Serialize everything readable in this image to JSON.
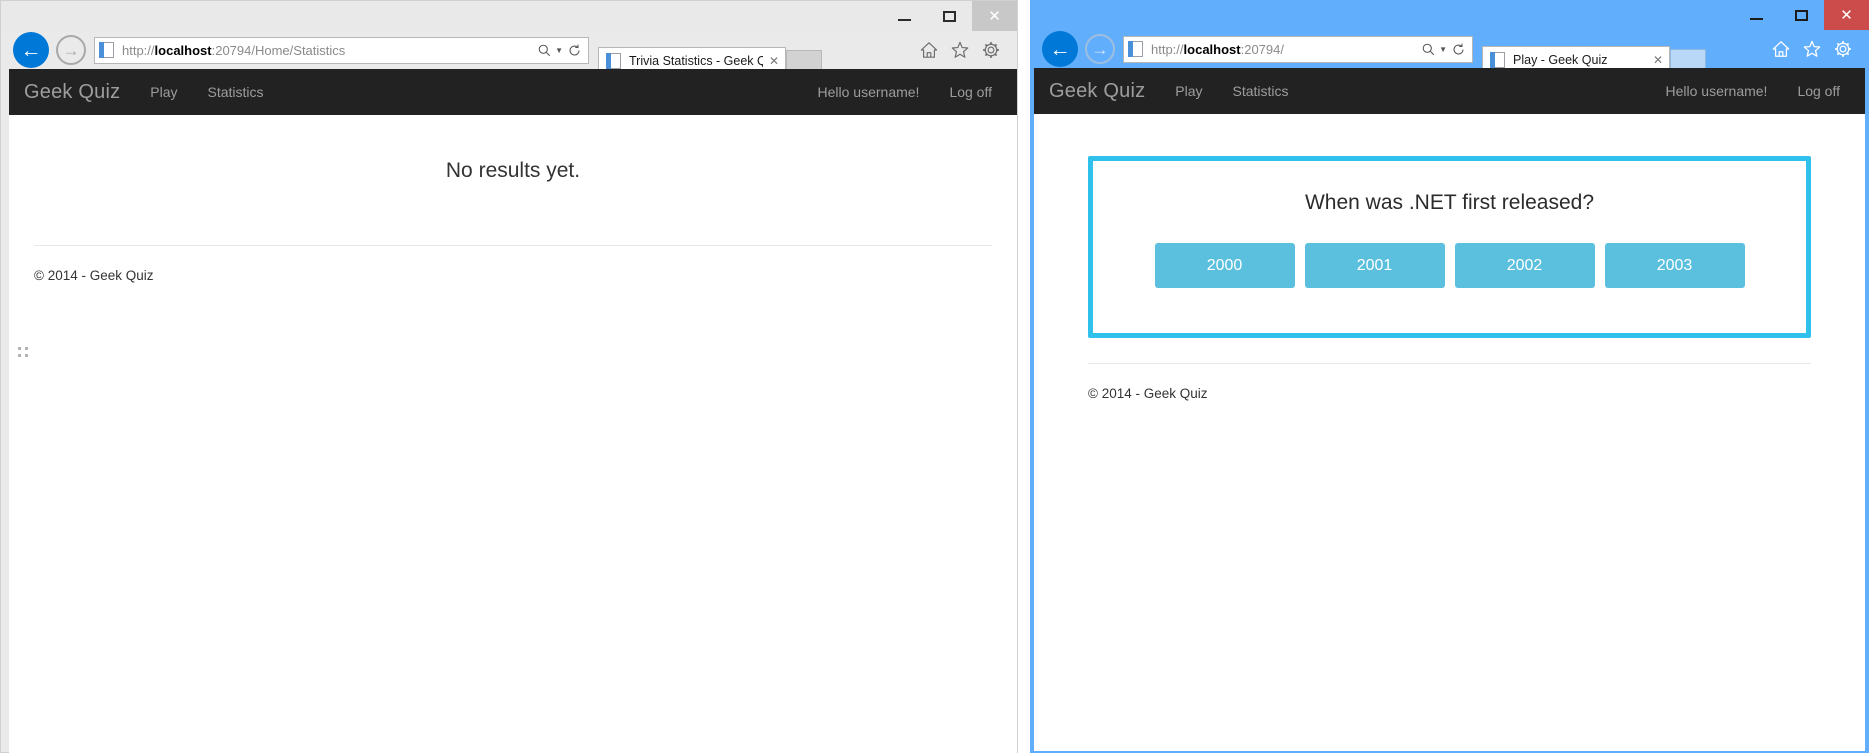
{
  "desktop": {
    "background_color": "#ffffff"
  },
  "windows": [
    {
      "id": "left",
      "active": false,
      "titlebar": {
        "minimize_label": "–",
        "maximize_label": "▢",
        "close_label": "✕"
      },
      "toolbar": {
        "back_label": "←",
        "forward_label": "→",
        "address": {
          "protocol": "http://",
          "host": "localhost",
          "path": ":20794/Home/Statistics",
          "full_url": "http://localhost:20794/Home/Statistics",
          "page_icon": "page-icon"
        },
        "search_icon": "search-icon",
        "dropdown_icon": "chevron-down-icon",
        "refresh_icon": "refresh-icon",
        "tab": {
          "title": "Trivia Statistics - Geek Quiz",
          "close_label": "✕"
        },
        "new_tab_label": "",
        "home_icon": "home-icon",
        "favorites_icon": "star-icon",
        "settings_icon": "gear-icon"
      },
      "page": {
        "navbar": {
          "brand": "Geek Quiz",
          "links": [
            {
              "label": "Play",
              "name": "nav-link-play"
            },
            {
              "label": "Statistics",
              "name": "nav-link-statistics"
            }
          ],
          "greeting": "Hello username!",
          "logoff": "Log off"
        },
        "main": {
          "message": "No results yet."
        },
        "footer": {
          "copyright": "© 2014 - Geek Quiz"
        }
      }
    },
    {
      "id": "right",
      "active": true,
      "titlebar": {
        "minimize_label": "–",
        "maximize_label": "▢",
        "close_label": "✕",
        "close_color": "#cc4c4c"
      },
      "toolbar": {
        "back_label": "←",
        "forward_label": "→",
        "address": {
          "protocol": "http://",
          "host": "localhost",
          "path": ":20794/",
          "full_url": "http://localhost:20794/",
          "page_icon": "page-icon"
        },
        "search_icon": "search-icon",
        "dropdown_icon": "chevron-down-icon",
        "refresh_icon": "refresh-icon",
        "tab": {
          "title": "Play - Geek Quiz",
          "close_label": "✕"
        },
        "new_tab_label": "",
        "home_icon": "home-icon",
        "favorites_icon": "star-icon",
        "settings_icon": "gear-icon"
      },
      "page": {
        "navbar": {
          "brand": "Geek Quiz",
          "links": [
            {
              "label": "Play",
              "name": "nav-link-play"
            },
            {
              "label": "Statistics",
              "name": "nav-link-statistics"
            }
          ],
          "greeting": "Hello username!",
          "logoff": "Log off"
        },
        "quiz": {
          "question": "When was .NET first released?",
          "options": [
            {
              "label": "2000"
            },
            {
              "label": "2001"
            },
            {
              "label": "2002"
            },
            {
              "label": "2003"
            }
          ],
          "panel_border_color": "#2fc0eb",
          "option_color": "#5bc0de"
        },
        "footer": {
          "copyright": "© 2014 - Geek Quiz"
        }
      }
    }
  ]
}
